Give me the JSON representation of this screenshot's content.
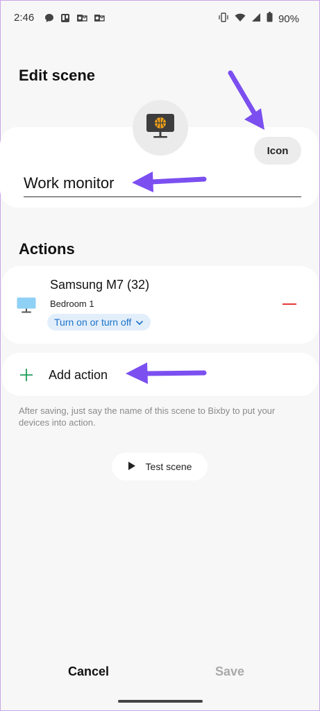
{
  "status_bar": {
    "time": "2:46",
    "notification_icons": [
      "chat-bubble-icon",
      "trello-icon",
      "outlook-icon",
      "outlook-icon"
    ],
    "system_icons": [
      "vibrate-icon",
      "wifi-icon",
      "signal-icon",
      "battery-icon"
    ],
    "battery": "90%"
  },
  "page": {
    "title": "Edit scene"
  },
  "scene": {
    "icon": "monitor-basketball-icon",
    "icon_button_label": "Icon",
    "name_value": "Work monitor"
  },
  "actions": {
    "title": "Actions",
    "items": [
      {
        "icon": "tv-monitor-icon",
        "device_name": "Samsung M7 (32)",
        "room": "Bedroom 1",
        "action_value": "Turn on or turn off"
      }
    ],
    "add_label": "Add action"
  },
  "hint": "After saving, just say the name of this scene to Bixby to put your devices into action.",
  "test_button_label": "Test scene",
  "footer": {
    "cancel_label": "Cancel",
    "save_label": "Save"
  },
  "colors": {
    "accent_blue": "#1a73c8",
    "remove_red": "#e5393a",
    "add_green": "#1f9e5a",
    "annotation_purple": "#7b4ff0"
  }
}
